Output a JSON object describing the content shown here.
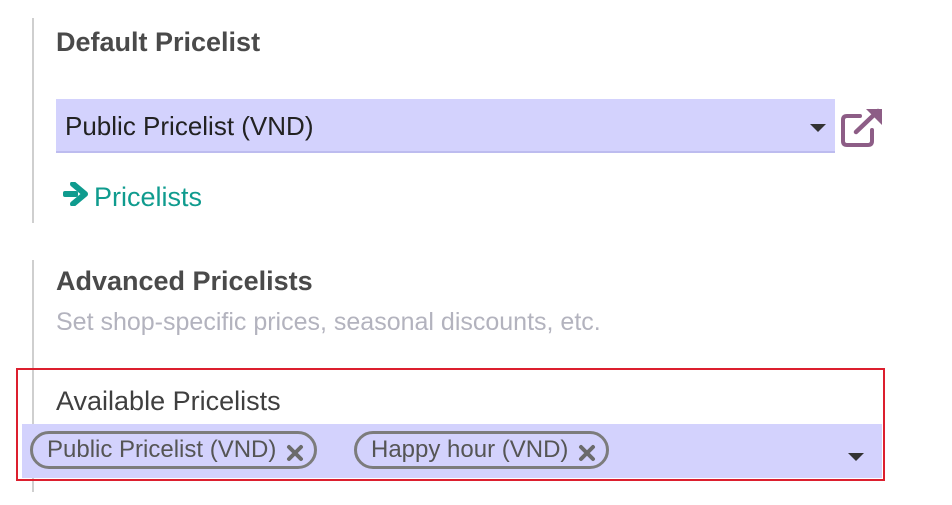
{
  "default_pricelist": {
    "title": "Default Pricelist",
    "selected_value": "Public Pricelist (VND)",
    "link_label": "Pricelists"
  },
  "advanced_pricelists": {
    "title": "Advanced Pricelists",
    "description": "Set shop-specific prices, seasonal discounts, etc.",
    "field_label": "Available Pricelists",
    "tags": [
      {
        "label": "Public Pricelist (VND)"
      },
      {
        "label": "Happy hour (VND)"
      }
    ]
  },
  "colors": {
    "input_bg": "#d3d2fd",
    "link_teal": "#0f9b8e",
    "external_icon": "#8d5d86",
    "highlight_red": "#dc1f2e"
  },
  "icons": [
    "chevron-down-icon",
    "external-link-icon",
    "arrow-right-icon",
    "remove-tag-icon"
  ]
}
